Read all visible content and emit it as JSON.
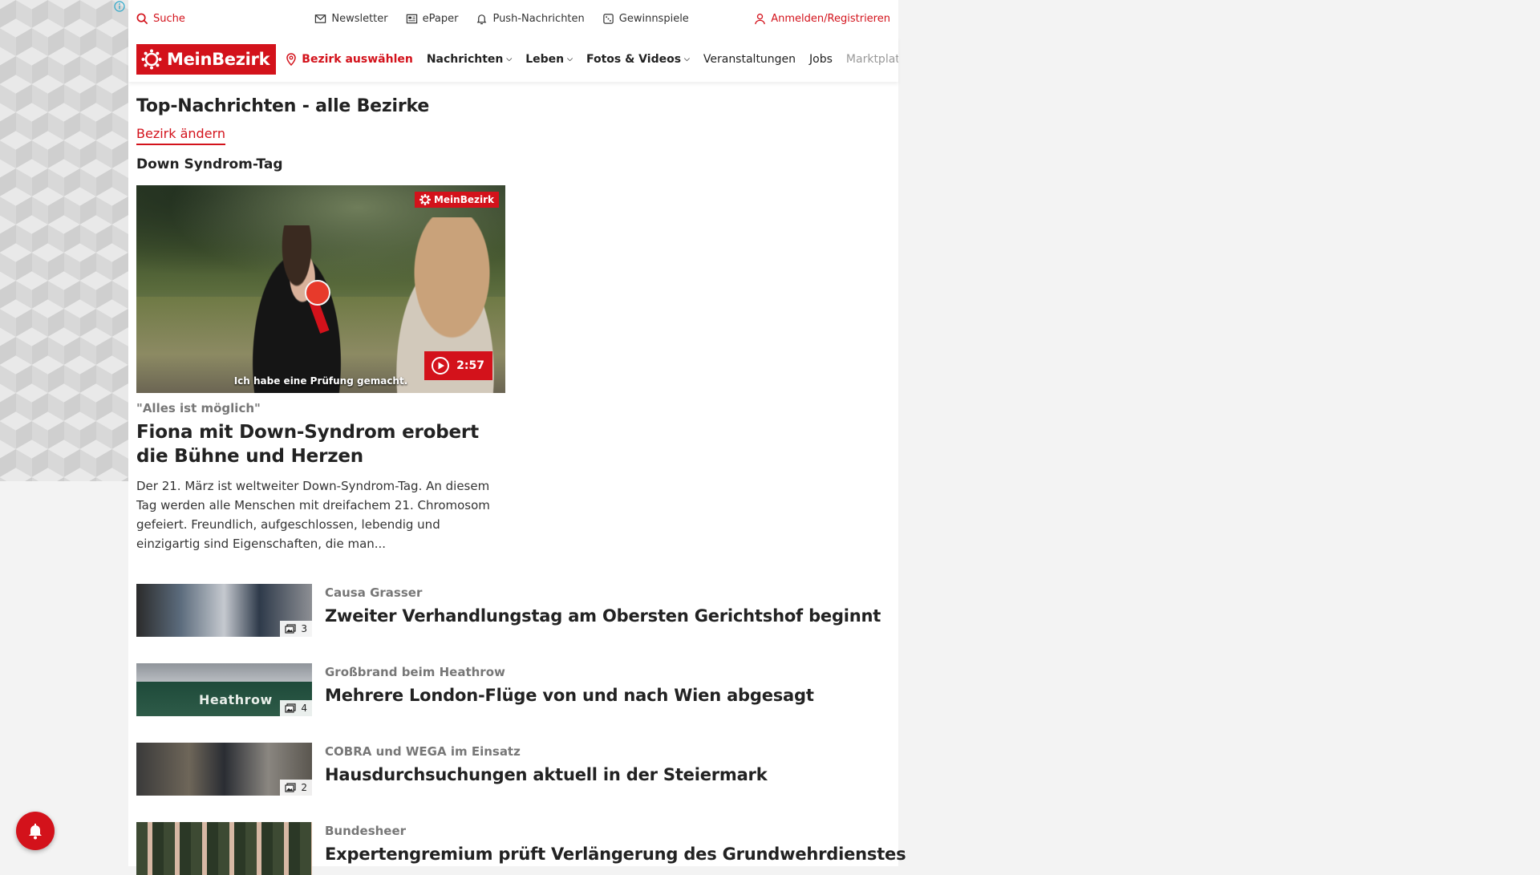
{
  "utility": {
    "search": "Suche",
    "newsletter": "Newsletter",
    "epaper": "ePaper",
    "push": "Push-Nachrichten",
    "contests": "Gewinnspiele",
    "login": "Anmelden/Registrieren"
  },
  "nav": {
    "logo": "MeinBezirk",
    "district": "Bezirk auswählen",
    "items": [
      "Nachrichten",
      "Leben",
      "Fotos & Videos",
      "Veranstaltungen",
      "Jobs",
      "Marktplatz"
    ]
  },
  "main": {
    "title": "Top-Nachrichten - alle Bezirke",
    "change_district": "Bezirk ändern",
    "topic": "Down Syndrom-Tag",
    "lead": {
      "badge": "MeinBezirk",
      "caption": "Ich habe eine Prüfung gemacht.",
      "duration": "2:57",
      "kicker": "\"Alles ist möglich\"",
      "title": "Fiona mit Down-Syndrom erobert die Bühne und Herzen",
      "teaser": "Der 21. März ist weltweiter Down-Syndrom-Tag. An diesem Tag werden alle Menschen mit dreifachem 21. Chromosom gefeiert. Freundlich, aufgeschlossen, lebendig und einzigartig sind Eigenschaften, die man..."
    },
    "list": [
      {
        "kicker": "Causa Grasser",
        "title": "Zweiter Verhandlungstag am Obersten Gerichtshof beginnt",
        "count": "3"
      },
      {
        "kicker": "Großbrand beim Heathrow",
        "title": "Mehrere London-Flüge von und nach Wien abgesagt",
        "count": "4",
        "sign": "Heathrow"
      },
      {
        "kicker": "COBRA und WEGA im Einsatz",
        "title": "Hausdurchsuchungen aktuell in der Steiermark",
        "count": "2"
      },
      {
        "kicker": "Bundesheer",
        "title": "Expertengremium prüft Verlängerung des Grundwehrdienstes",
        "count": ""
      }
    ]
  },
  "colors": {
    "brand": "#d3121b"
  }
}
